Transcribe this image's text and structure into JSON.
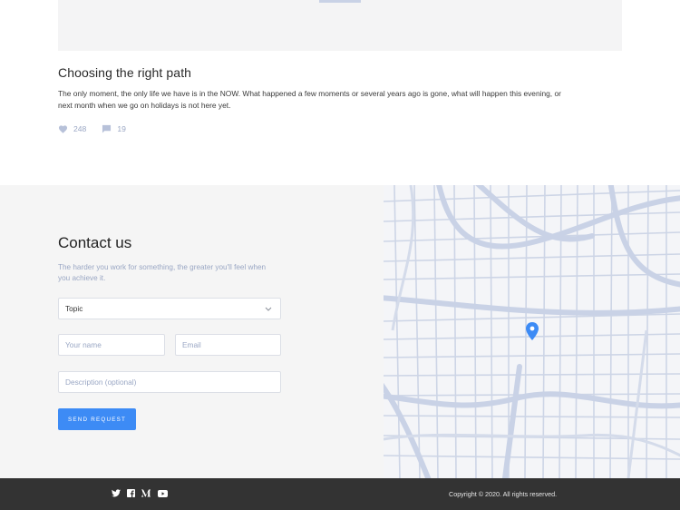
{
  "article": {
    "title": "Choosing the right path",
    "body": "The only moment, the only life we have is in the NOW. What happened a few moments or several years ago is gone, what will happen this evening, or next month when we go on holidays is not here yet.",
    "likes": "248",
    "comments": "19",
    "icons": [
      "heart-icon",
      "comment-icon"
    ]
  },
  "contact": {
    "title": "Contact us",
    "subtitle": "The harder you work for something, the greater you'll feel when you achieve it.",
    "topic_select": {
      "value": "Topic",
      "icon": "chevron-down-icon"
    },
    "name_placeholder": "Your name",
    "email_placeholder": "Email",
    "description_placeholder": "Description (optional)",
    "send_label": "Send request",
    "accent_color": "#3d8bf5"
  },
  "map": {
    "pin_icon": "map-pin-icon",
    "pin_color": "#3d8bf5",
    "road_color": "#c9d2e6"
  },
  "footer": {
    "social_icons": [
      "twitter-icon",
      "facebook-icon",
      "medium-icon",
      "youtube-icon"
    ],
    "copyright": "Copyright © 2020. All rights reserved."
  }
}
